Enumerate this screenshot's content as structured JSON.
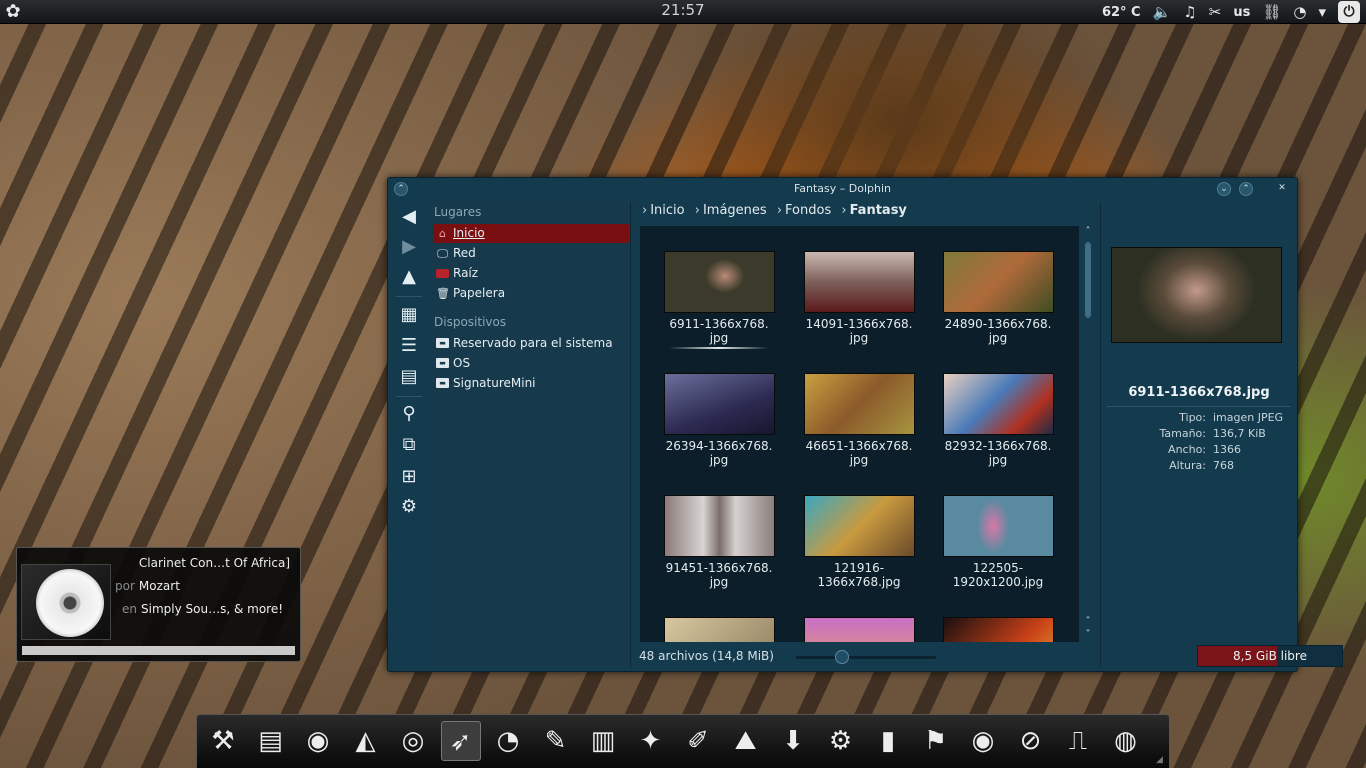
{
  "top_panel": {
    "clock": "21:57",
    "temperature": "62° C",
    "keyboard_layout": "us",
    "icons": [
      "launcher-icon",
      "volume-icon",
      "music-icon",
      "tools-icon",
      "network-icon",
      "wifi-icon",
      "menu-arrow-icon",
      "power-icon"
    ]
  },
  "media_player": {
    "title": "Clarinet Con…t Of Africa]",
    "by_label": "por",
    "artist": "Mozart",
    "in_label": "en",
    "album": "Simply Sou…s, & more!",
    "progress": 0
  },
  "window": {
    "title": "Fantasy – Dolphin",
    "breadcrumb": [
      "Inicio",
      "Imágenes",
      "Fondos",
      "Fantasy"
    ],
    "places_title": "Lugares",
    "places": [
      {
        "label": "Inicio",
        "icon": "home-icon",
        "active": true
      },
      {
        "label": "Red",
        "icon": "network-icon",
        "active": false
      },
      {
        "label": "Raíz",
        "icon": "folder-icon",
        "active": false
      },
      {
        "label": "Papelera",
        "icon": "trash-icon",
        "active": false
      }
    ],
    "devices_title": "Dispositivos",
    "devices": [
      {
        "label": "Reservado para el sistema",
        "icon": "drive-icon"
      },
      {
        "label": "OS",
        "icon": "drive-icon"
      },
      {
        "label": "SignatureMini",
        "icon": "usb-drive-icon"
      }
    ],
    "files": [
      {
        "name1": "6911-1366x768.",
        "name2": "jpg",
        "selected": true
      },
      {
        "name1": "14091-1366x768.",
        "name2": "jpg",
        "selected": false
      },
      {
        "name1": "24890-1366x768.",
        "name2": "jpg",
        "selected": false
      },
      {
        "name1": "26394-1366x768.",
        "name2": "jpg",
        "selected": false
      },
      {
        "name1": "46651-1366x768.",
        "name2": "jpg",
        "selected": false
      },
      {
        "name1": "82932-1366x768.",
        "name2": "jpg",
        "selected": false
      },
      {
        "name1": "91451-1366x768.",
        "name2": "jpg",
        "selected": false
      },
      {
        "name1": "121916-",
        "name2": "1366x768.jpg",
        "selected": false
      },
      {
        "name1": "122505-",
        "name2": "1920x1200.jpg",
        "selected": false
      },
      {
        "name1": "",
        "name2": "",
        "selected": false
      },
      {
        "name1": "",
        "name2": "",
        "selected": false
      },
      {
        "name1": "",
        "name2": "",
        "selected": false
      }
    ],
    "info": {
      "filename": "6911-1366x768.jpg",
      "rows": [
        {
          "key": "Tipo:",
          "value": "imagen JPEG"
        },
        {
          "key": "Tamaño:",
          "value": "136,7 KiB"
        },
        {
          "key": "Ancho:",
          "value": "1366"
        },
        {
          "key": "Altura:",
          "value": "768"
        }
      ]
    },
    "status": "48 archivos (14,8 MiB)",
    "free_space": "8,5 GiB libre",
    "free_space_used_fraction": 0.55,
    "zoom_level_fraction": 0.33
  },
  "dock": {
    "items": [
      "system-tools-icon",
      "file-manager-icon",
      "firefox-icon",
      "gimp-icon",
      "chrome-icon",
      "kde-icon",
      "fan-icon",
      "dolphin-kit-icon",
      "lm-icon",
      "owl-icon",
      "paint-icon",
      "inkscape-icon",
      "download-icon",
      "settings-icon",
      "document-icon",
      "flag-icon",
      "eye-icon",
      "disc-icon",
      "monitor-icon",
      "burn-icon"
    ],
    "active_index": 5
  }
}
